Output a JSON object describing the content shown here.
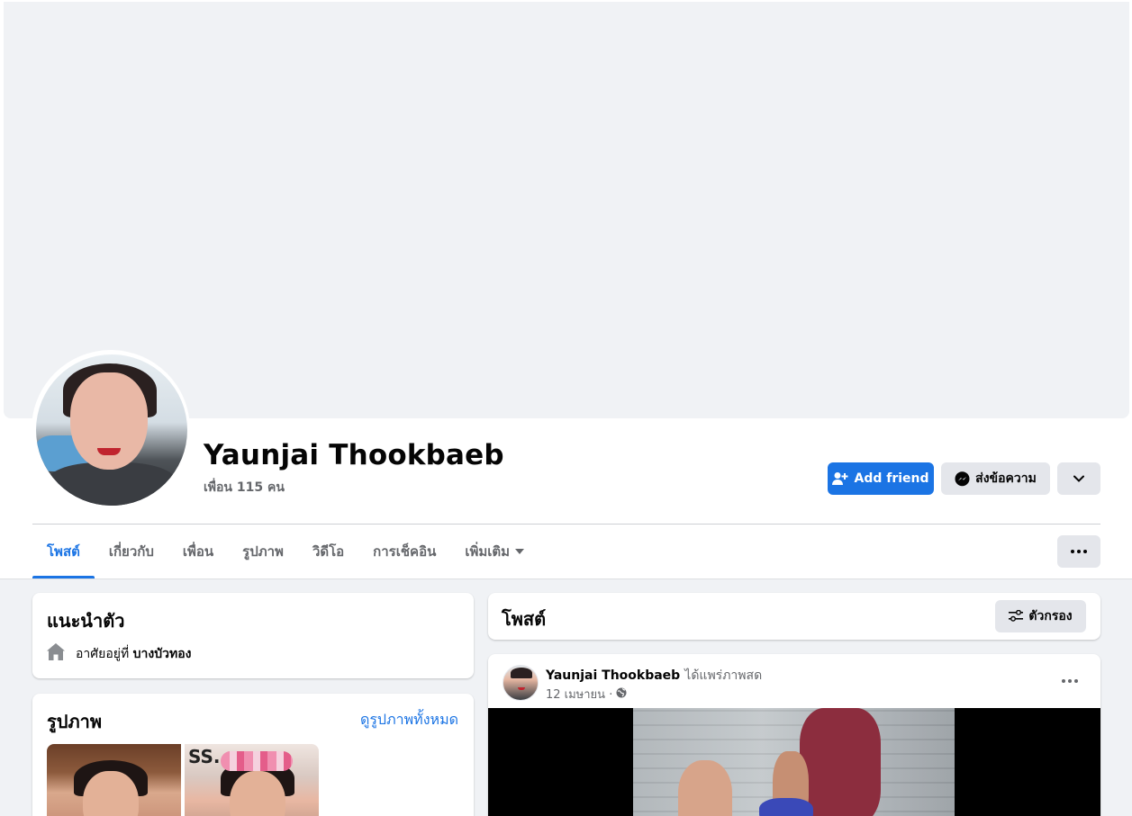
{
  "profile": {
    "name": "Yaunjai Thookbaeb",
    "friends_count": "เพื่อน 115 คน"
  },
  "actions": {
    "add_friend": "Add friend",
    "message": "ส่งข้อความ"
  },
  "tabs": [
    {
      "label": "โพสต์",
      "active": true
    },
    {
      "label": "เกี่ยวกับ"
    },
    {
      "label": "เพื่อน"
    },
    {
      "label": "รูปภาพ"
    },
    {
      "label": "วิดีโอ"
    },
    {
      "label": "การเช็คอิน"
    },
    {
      "label": "เพิ่มเติม"
    }
  ],
  "intro": {
    "title": "แนะนำตัว",
    "lives_prefix": "อาศัยอยู่ที่",
    "lives_place": "บางบัวทอง"
  },
  "photos": {
    "title": "รูปภาพ",
    "see_all": "ดูรูปภาพทั้งหมด"
  },
  "posts_header": {
    "title": "โพสต์",
    "filter": "ตัวกรอง"
  },
  "post": {
    "author": "Yaunjai Thookbaeb",
    "action": "ได้แพร่ภาพสด",
    "date": "12 เมษายน ·"
  },
  "colors": {
    "accent": "#1b74e4",
    "page_bg": "#f0f2f5",
    "secondary_text": "#65676b"
  }
}
